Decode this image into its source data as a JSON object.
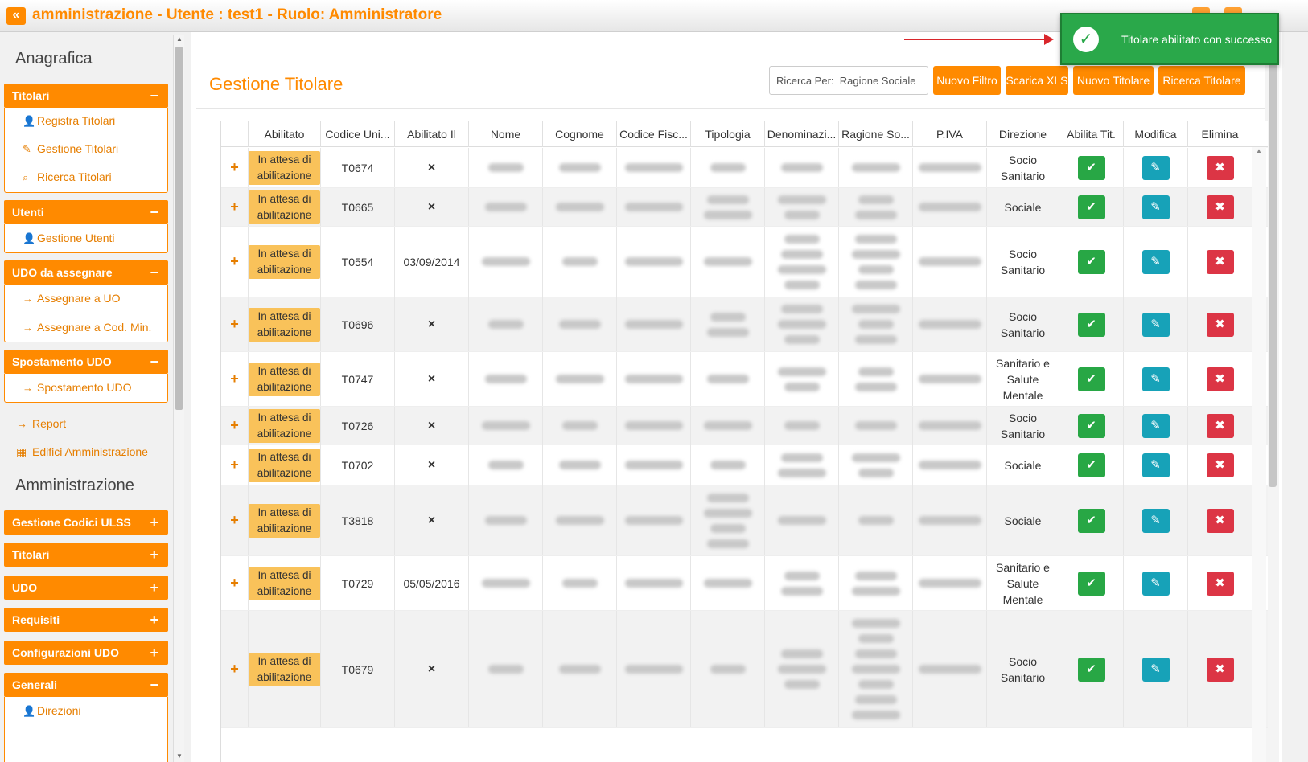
{
  "header": {
    "collapse_label": "«",
    "title": "amministrazione - Utente : test1 - Ruolo: Amministratore"
  },
  "toast": {
    "message": "Titolare abilitato con successo",
    "icon": "check-circle-icon"
  },
  "sidebar": {
    "anagrafica_title": "Anagrafica",
    "amministrazione_title": "Amministrazione",
    "groups": [
      {
        "label": "Titolari",
        "toggle": "−",
        "items": [
          "Registra Titolari",
          "Gestione Titolari",
          "Ricerca Titolari"
        ]
      },
      {
        "label": "Utenti",
        "toggle": "−",
        "items": [
          "Gestione Utenti"
        ]
      },
      {
        "label": "UDO da assegnare",
        "toggle": "−",
        "items": [
          "Assegnare a UO",
          "Assegnare a Cod. Min."
        ]
      },
      {
        "label": "Spostamento UDO",
        "toggle": "−",
        "items": [
          "Spostamento UDO"
        ]
      }
    ],
    "free_items": [
      "Report",
      "Edifici Amministrazione"
    ],
    "admin_groups": [
      {
        "label": "Gestione Codici ULSS",
        "toggle": "+"
      },
      {
        "label": "Titolari",
        "toggle": "+"
      },
      {
        "label": "UDO",
        "toggle": "+"
      },
      {
        "label": "Requisiti",
        "toggle": "+"
      },
      {
        "label": "Configurazioni UDO",
        "toggle": "+"
      },
      {
        "label": "Generali",
        "toggle": "−",
        "items": [
          "Direzioni"
        ]
      }
    ]
  },
  "main": {
    "page_title": "Gestione Titolare",
    "search": {
      "label": "Ricerca Per:",
      "value": "Ragione Sociale"
    },
    "buttons": [
      "Nuovo Filtro",
      "Scarica XLS",
      "Nuovo Titolare",
      "Ricerca Titolare"
    ]
  },
  "table": {
    "columns": [
      "Abilitato",
      "Codice Uni...",
      "Abilitato Il",
      "Nome",
      "Cognome",
      "Codice Fisc...",
      "Tipologia",
      "Denominazi...",
      "Ragione So...",
      "P.IVA",
      "Direzione",
      "Abilita Tit.",
      "Modifica",
      "Elimina"
    ],
    "pending_label": "In attesa di abilitazione",
    "rows": [
      {
        "codice": "T0674",
        "abilitato_il": "×",
        "direzione": "Socio Sanitario"
      },
      {
        "codice": "T0665",
        "abilitato_il": "×",
        "direzione": "Sociale"
      },
      {
        "codice": "T0554",
        "abilitato_il": "03/09/2014",
        "direzione": "Socio Sanitario"
      },
      {
        "codice": "T0696",
        "abilitato_il": "×",
        "direzione": "Socio Sanitario"
      },
      {
        "codice": "T0747",
        "abilitato_il": "×",
        "direzione": "Sanitario e Salute Mentale"
      },
      {
        "codice": "T0726",
        "abilitato_il": "×",
        "direzione": "Socio Sanitario"
      },
      {
        "codice": "T0702",
        "abilitato_il": "×",
        "direzione": "Sociale"
      },
      {
        "codice": "T3818",
        "abilitato_il": "×",
        "direzione": "Sociale"
      },
      {
        "codice": "T0729",
        "abilitato_il": "05/05/2016",
        "direzione": "Sanitario e Salute Mentale"
      },
      {
        "codice": "T0679",
        "abilitato_il": "×",
        "direzione": "Socio Sanitario"
      }
    ]
  }
}
